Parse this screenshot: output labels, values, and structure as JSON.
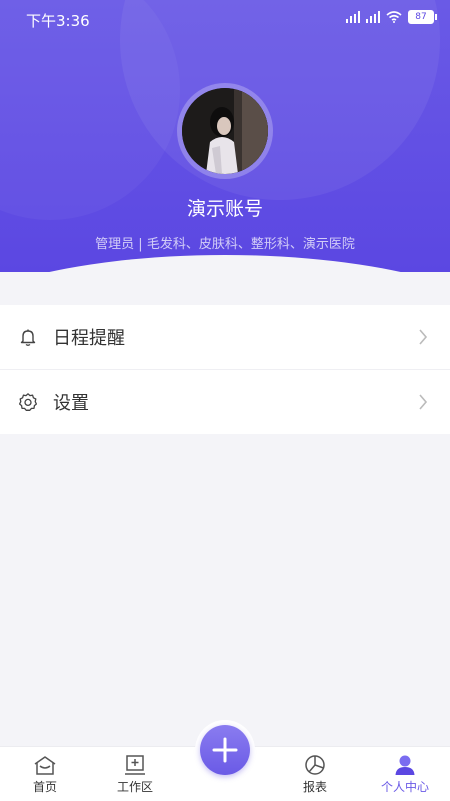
{
  "status_bar": {
    "time": "下午3:36",
    "battery": "87"
  },
  "profile": {
    "account_name": "演示账号",
    "description": "管理员 | 毛发科、皮肤科、整形科、演示医院"
  },
  "menu": [
    {
      "label": "日程提醒",
      "icon": "bell-icon"
    },
    {
      "label": "设置",
      "icon": "gear-icon"
    }
  ],
  "tabbar": {
    "tabs": [
      {
        "label": "首页",
        "icon": "home-icon"
      },
      {
        "label": "工作区",
        "icon": "workspace-icon"
      },
      {
        "label": "报表",
        "icon": "chart-icon"
      },
      {
        "label": "个人中心",
        "icon": "person-icon",
        "active": true
      }
    ],
    "fab_icon": "plus-icon"
  },
  "colors": {
    "accent": "#6a5ae6",
    "header": "#5b47e2",
    "background": "#f4f4f8"
  }
}
